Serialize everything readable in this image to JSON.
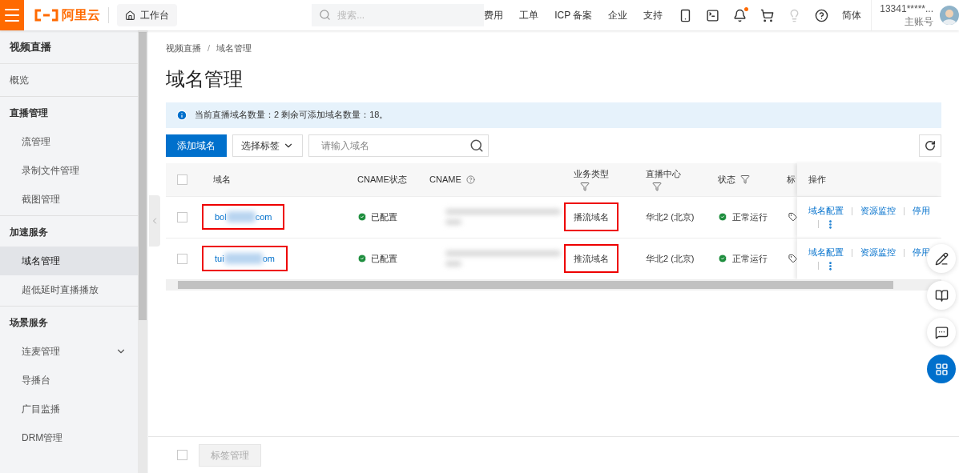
{
  "topbar": {
    "logo_text": "阿里云",
    "workbench": "工作台",
    "search": {
      "placeholder": "搜索..."
    },
    "links": [
      "费用",
      "工单",
      "ICP 备案",
      "企业",
      "支持"
    ],
    "notification_dot": true,
    "language": "简体",
    "account": {
      "name": "13341*****...",
      "role": "主账号"
    }
  },
  "sidebar": {
    "title": "视频直播",
    "sections": [
      {
        "items": [
          {
            "label": "概览",
            "selected": false
          }
        ]
      },
      {
        "heading": "直播管理",
        "items": [
          {
            "label": "流管理",
            "selected": false
          },
          {
            "label": "录制文件管理",
            "selected": false
          },
          {
            "label": "截图管理",
            "selected": false
          }
        ]
      },
      {
        "heading": "加速服务",
        "items": [
          {
            "label": "域名管理",
            "selected": true
          },
          {
            "label": "超低延时直播播放",
            "selected": false
          }
        ]
      },
      {
        "heading": "场景服务",
        "items": [
          {
            "label": "连麦管理",
            "selected": false,
            "expandable": true
          },
          {
            "label": "导播台",
            "selected": false
          },
          {
            "label": "广目监播",
            "selected": false
          },
          {
            "label": "DRM管理",
            "selected": false
          }
        ]
      }
    ]
  },
  "breadcrumb": {
    "items": [
      "视频直播",
      "域名管理"
    ],
    "separator": "/"
  },
  "title": "域名管理",
  "notice": "当前直播域名数量：2 剩余可添加域名数量：18。",
  "toolbar": {
    "add_button": "添加域名",
    "tag_select": "选择标签",
    "search": {
      "placeholder": "请输入域名"
    }
  },
  "table": {
    "header_checked": false,
    "columns": [
      {
        "label": "域名",
        "filter": false,
        "help": false
      },
      {
        "label": "CNAME状态",
        "filter": false,
        "help": false
      },
      {
        "label": "CNAME",
        "filter": false,
        "help": true
      },
      {
        "label": "业务类型",
        "filter": true,
        "help": false
      },
      {
        "label": "直播中心",
        "filter": true,
        "help": false
      },
      {
        "label": "状态",
        "filter": true,
        "help": false
      },
      {
        "label": "标",
        "filter": false,
        "help": false
      }
    ],
    "actions_label": "操作",
    "rows": [
      {
        "checked": false,
        "domain_start": "bol",
        "domain_end": "com",
        "domain_highlighted": true,
        "cname_status": "已配置",
        "type": "播流域名",
        "type_highlighted": true,
        "center": "华北2 (北京)",
        "status": "正常运行",
        "actions": [
          "域名配置",
          "资源监控",
          "停用"
        ]
      },
      {
        "checked": false,
        "domain_start": "tui",
        "domain_end": "om",
        "domain_highlighted": true,
        "cname_status": "已配置",
        "type": "推流域名",
        "type_highlighted": true,
        "center": "华北2 (北京)",
        "status": "正常运行",
        "actions": [
          "域名配置",
          "资源监控",
          "停用"
        ]
      }
    ]
  },
  "footer": {
    "checked": false,
    "tag_button": "标签管理",
    "tag_button_disabled": true
  }
}
